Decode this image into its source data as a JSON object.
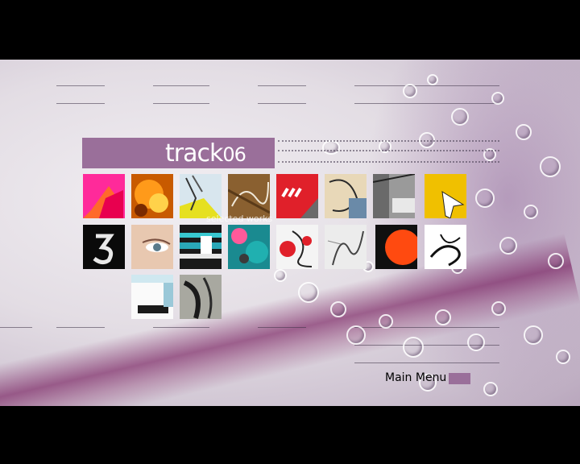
{
  "header": {
    "title_word": "track",
    "title_number": "06"
  },
  "overlay_caption": "selected works",
  "thumbnails": [
    "magenta-triangle",
    "orange-fire",
    "yellow-sketch",
    "brown-lines",
    "red-stripes",
    "beige-drawing",
    "street-photo",
    "yellow-arrow",
    "black-glyph",
    "eye-closeup",
    "teal-dots",
    "teal-collage",
    "red-white-flowers",
    "white-sketch",
    "orange-circle",
    "line-art",
    "white-window",
    "gray-curve"
  ],
  "footer": {
    "main_menu_label": "Main Menu"
  },
  "colors": {
    "accent": "#9a6f9a"
  }
}
